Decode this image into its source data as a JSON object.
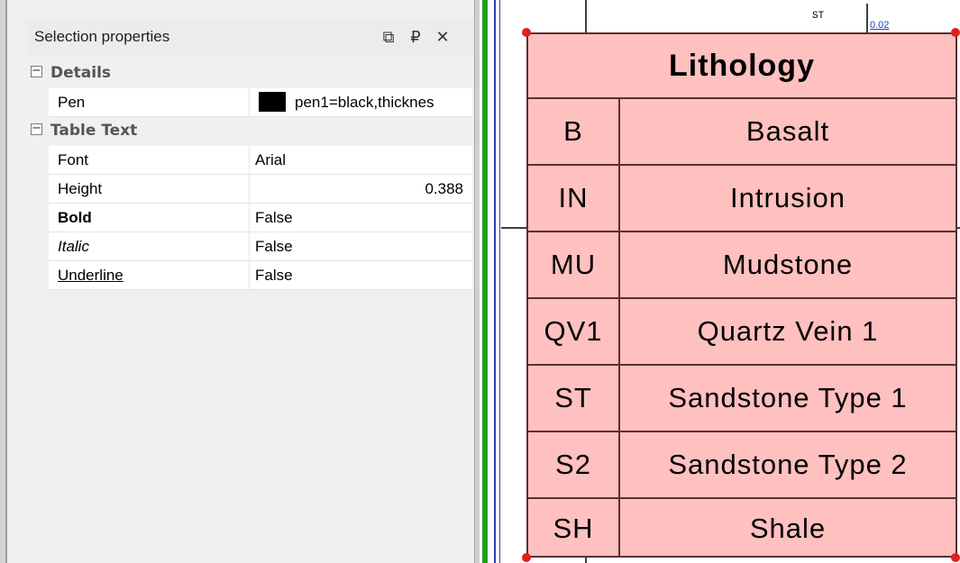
{
  "panel": {
    "title": "Selection properties",
    "buttons": {
      "float": "⧉",
      "pin": "₽",
      "close": "✕"
    }
  },
  "properties": {
    "details": {
      "label": "Details",
      "toggle": "⊟",
      "pen": {
        "name": "Pen",
        "value": "pen1=black,thicknes"
      }
    },
    "table_text": {
      "label": "Table Text",
      "toggle": "⊟",
      "font": {
        "name": "Font",
        "value": "Arial"
      },
      "height": {
        "name": "Height",
        "value": "0.388"
      },
      "bold": {
        "name": "Bold",
        "value": "False"
      },
      "italic": {
        "name": "Italic",
        "value": "False"
      },
      "underline": {
        "name": "Underline",
        "value": "False"
      }
    }
  },
  "canvas": {
    "top_label": "ST",
    "top_value": "0.02",
    "table": {
      "title": "Lithology",
      "rows": [
        {
          "code": "B",
          "desc": "Basalt"
        },
        {
          "code": "IN",
          "desc": "Intrusion"
        },
        {
          "code": "MU",
          "desc": "Mudstone"
        },
        {
          "code": "QV1",
          "desc": "Quartz Vein 1"
        },
        {
          "code": "ST",
          "desc": "Sandstone Type 1"
        },
        {
          "code": "S2",
          "desc": "Sandstone Type 2"
        },
        {
          "code": "SH",
          "desc": "Shale"
        }
      ]
    }
  },
  "colors": {
    "table_fill": "#ffc0c0",
    "table_border": "#5a3030",
    "handle": "#e02020",
    "divider_green": "#20a020",
    "divider_blue": "#2c3eaa"
  }
}
